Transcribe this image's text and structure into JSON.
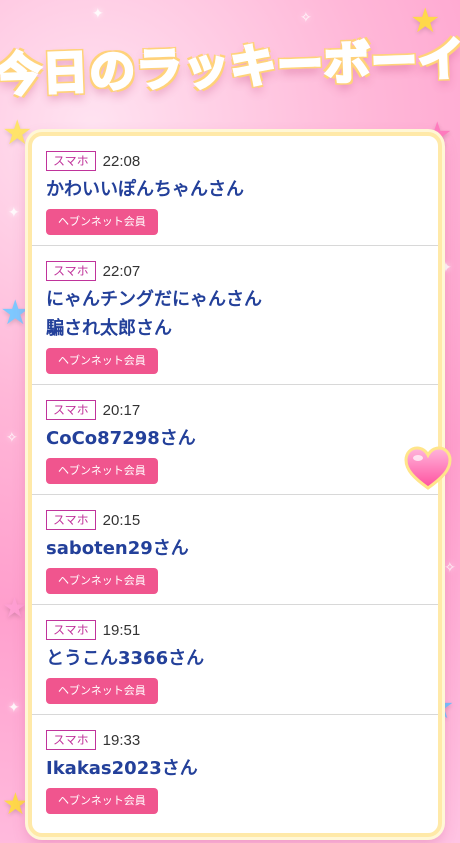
{
  "header": {
    "title": "今日のラッキーボーイ"
  },
  "entries": [
    {
      "device": "スマホ",
      "time": "22:08",
      "names": [
        "かわいいぽんちゃんさん"
      ],
      "member_label": "ヘブンネット会員"
    },
    {
      "device": "スマホ",
      "time": "22:07",
      "names": [
        "にゃんチングだにゃんさん",
        "騙され太郎さん"
      ],
      "member_label": "ヘブンネット会員"
    },
    {
      "device": "スマホ",
      "time": "20:17",
      "names": [
        "CoCo87298さん"
      ],
      "member_label": "ヘブンネット会員"
    },
    {
      "device": "スマホ",
      "time": "20:15",
      "names": [
        "saboten29さん"
      ],
      "member_label": "ヘブンネット会員"
    },
    {
      "device": "スマホ",
      "time": "19:51",
      "names": [
        "とうこん3366さん"
      ],
      "member_label": "ヘブンネット会員"
    },
    {
      "device": "スマホ",
      "time": "19:33",
      "names": [
        "Ikakas2023さん"
      ],
      "member_label": "ヘブンネット会員"
    }
  ],
  "colors": {
    "accent": "#f0558e",
    "name_text": "#23409a",
    "device_tag": "#c0339b"
  }
}
